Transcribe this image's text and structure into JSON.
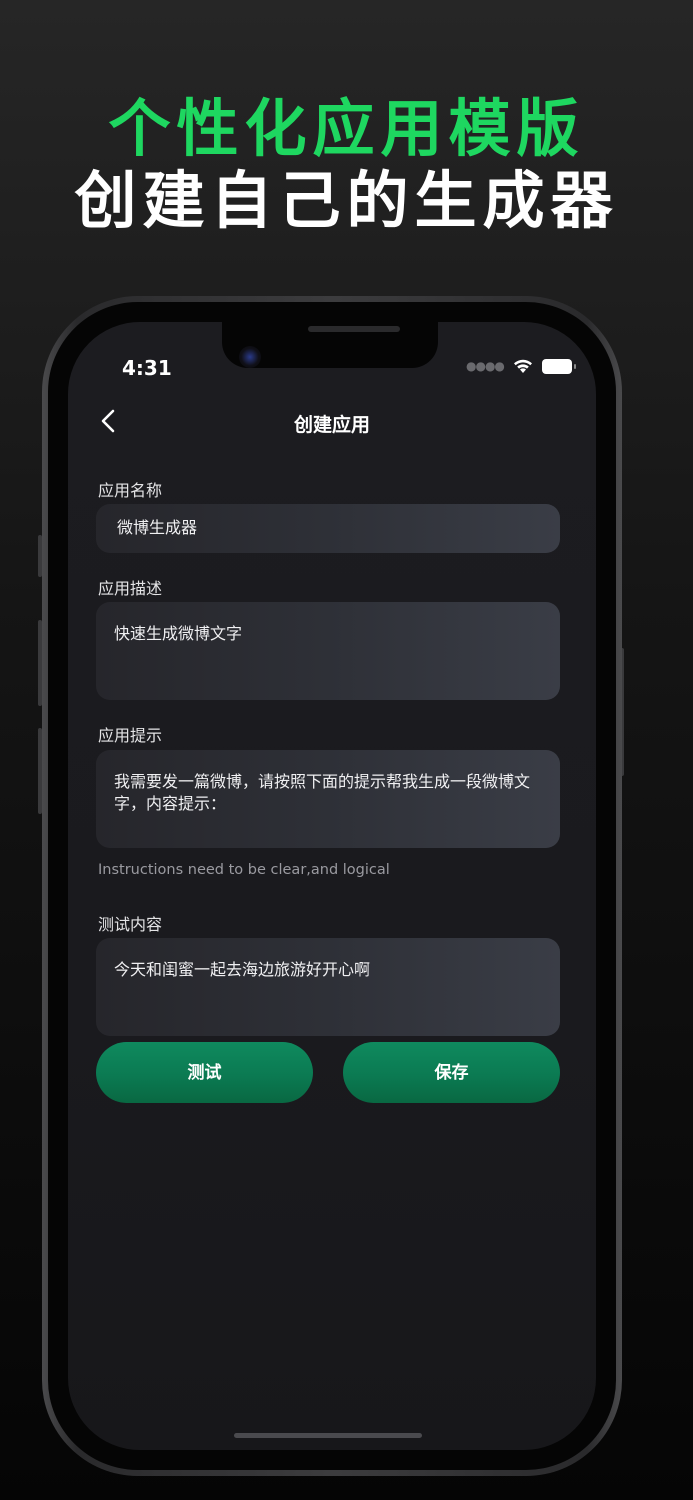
{
  "promo": {
    "headline_green": "个性化应用模版",
    "headline_white": "创建自己的生成器"
  },
  "status_bar": {
    "time": "4:31",
    "icons": [
      "signal-dots-icon",
      "wifi-icon",
      "battery-icon"
    ]
  },
  "nav": {
    "back_icon": "chevron-left-icon",
    "title": "创建应用"
  },
  "form": {
    "name": {
      "label": "应用名称",
      "value": "微博生成器"
    },
    "description": {
      "label": "应用描述",
      "value": "快速生成微博文字"
    },
    "prompt": {
      "label": "应用提示",
      "value": "我需要发一篇微博，请按照下面的提示帮我生成一段微博文字，内容提示：",
      "hint": "Instructions need to be clear,and logical"
    },
    "test": {
      "label": "测试内容",
      "value": "今天和闺蜜一起去海边旅游好开心啊"
    }
  },
  "actions": {
    "test_label": "测试",
    "save_label": "保存"
  },
  "colors": {
    "accent_green": "#1ed760",
    "button_green": "#0b7a52",
    "background": "#1c1c20"
  }
}
